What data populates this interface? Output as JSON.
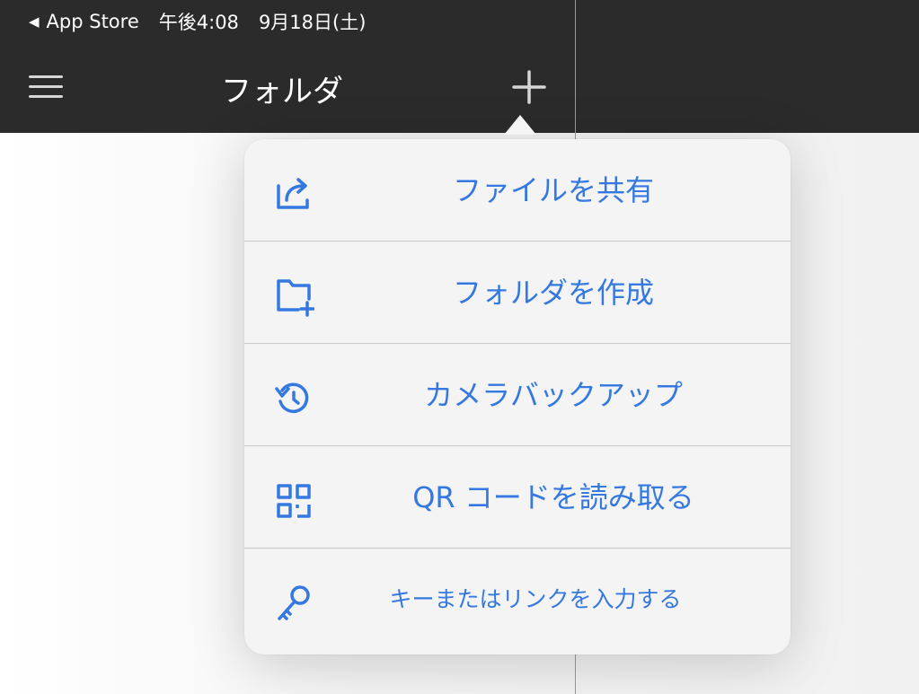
{
  "status_bar": {
    "back_app": "App Store",
    "time": "午後4:08",
    "date": "9月18日(土)"
  },
  "nav": {
    "title": "フォルダ",
    "menu_icon": "hamburger-icon",
    "add_icon": "plus-icon"
  },
  "popover": {
    "items": [
      {
        "label": "ファイルを共有",
        "icon": "share-icon"
      },
      {
        "label": "フォルダを作成",
        "icon": "folder-add-icon"
      },
      {
        "label": "カメラバックアップ",
        "icon": "backup-icon"
      },
      {
        "label": "QR コードを読み取る",
        "icon": "qr-code-icon"
      },
      {
        "label": "キーまたはリンクを入力する",
        "icon": "key-icon"
      }
    ]
  },
  "colors": {
    "accent": "#3478e0",
    "topbar": "#2b2b2b",
    "popover_bg": "#f4f4f4"
  }
}
